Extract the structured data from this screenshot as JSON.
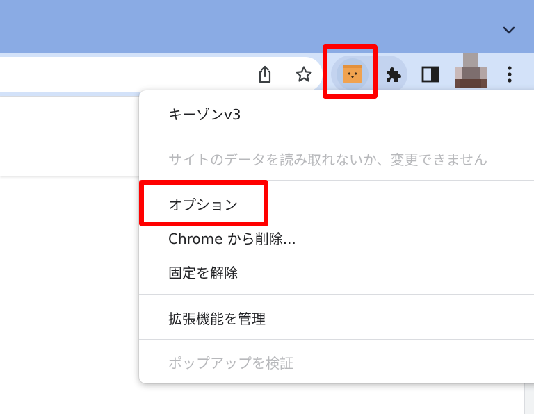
{
  "theme": {
    "tabstrip_color": "#8aabe4",
    "toolbar_color": "#d3e2f9",
    "highlight_color": "#ff0000",
    "extension_icon_color": "#f0a24f"
  },
  "toolbar": {
    "icons": [
      "tab-search-icon",
      "share-icon",
      "star-icon",
      "extension-danbo-icon",
      "puzzle-icon",
      "side-panel-icon",
      "kebab-menu-icon"
    ]
  },
  "extension_menu": {
    "extension_name": "キーゾンv3",
    "permission_note": "サイトのデータを読み取れないか、変更できません",
    "items": {
      "options": "オプション",
      "remove": "Chrome から削除...",
      "unpin": "固定を解除",
      "manage": "拡張機能を管理",
      "inspect_popup": "ポップアップを検証"
    }
  }
}
